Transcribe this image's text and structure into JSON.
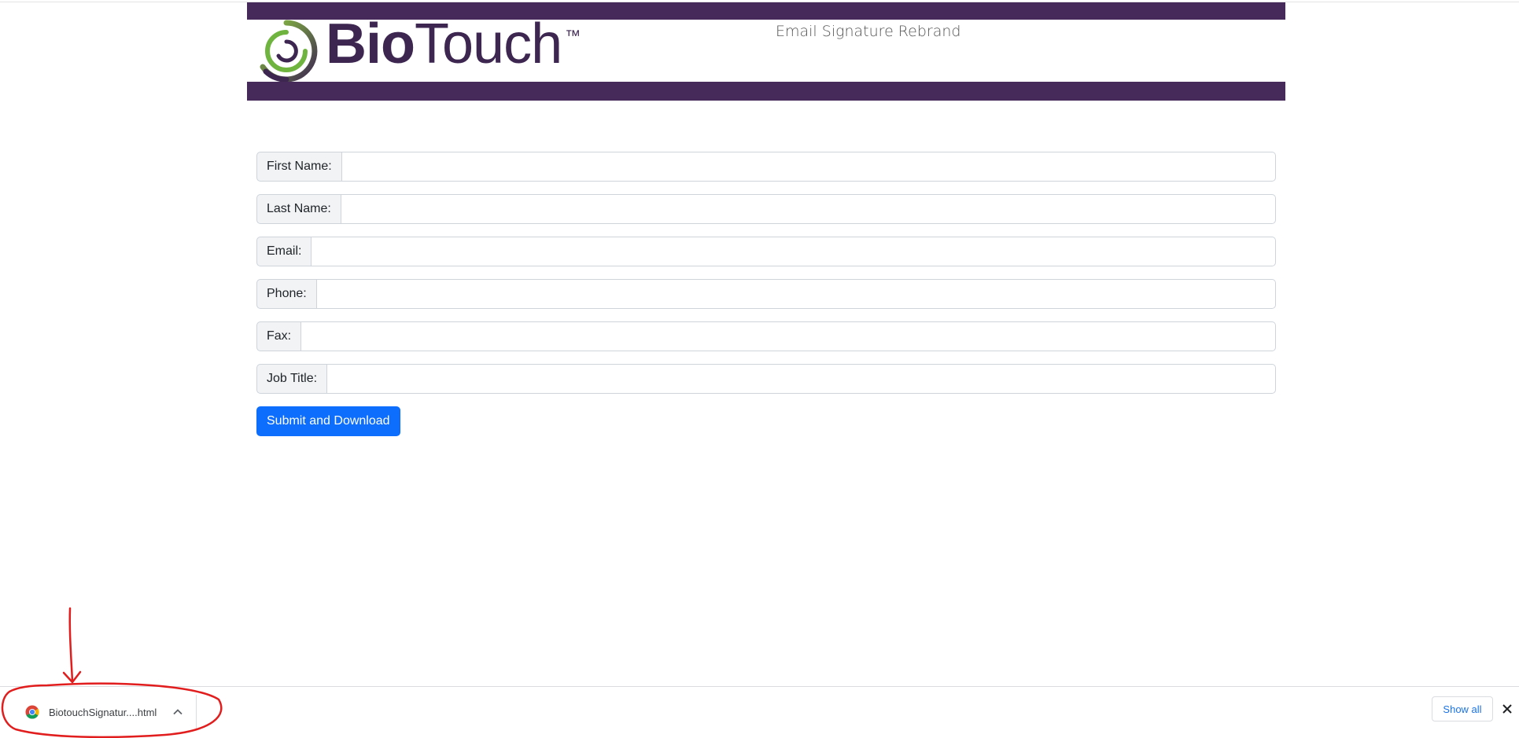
{
  "header": {
    "logo_bio": "Bio",
    "logo_touch": "Touch",
    "logo_tm": "™",
    "subtitle": "Email Signature Rebrand",
    "bar_color": "#452a5a",
    "logo_green": "#6fb43f"
  },
  "form": {
    "fields": [
      {
        "label": "First Name:",
        "value": ""
      },
      {
        "label": "Last Name:",
        "value": ""
      },
      {
        "label": "Email:",
        "value": ""
      },
      {
        "label": "Phone:",
        "value": ""
      },
      {
        "label": "Fax:",
        "value": ""
      },
      {
        "label": "Job Title:",
        "value": ""
      }
    ],
    "submit_label": "Submit and Download",
    "accent_color": "#0d6efd"
  },
  "download_bar": {
    "filename": "BiotouchSignatur....html",
    "show_all_label": "Show all",
    "icons": [
      "chrome-icon",
      "chevron-up-icon",
      "close-icon"
    ]
  },
  "annotation": {
    "color": "#e11d1d",
    "shapes": [
      "arrow-down",
      "circle"
    ]
  }
}
